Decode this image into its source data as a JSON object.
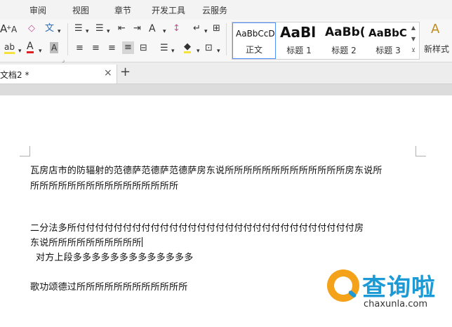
{
  "menu": [
    "审阅",
    "视图",
    "章节",
    "开发工具",
    "云服务"
  ],
  "ribbon": {
    "font_group": {
      "grow_font": "A",
      "shrink_font": "A",
      "clear_format": "◇",
      "pinyin": "文",
      "highlight": "ab",
      "font_color": "A",
      "char_shading": "A"
    },
    "paragraph_group": {
      "bullets": "☰",
      "numbering": "☰",
      "decrease_indent": "⇤",
      "increase_indent": "⇥",
      "cjk_layout": "A",
      "sort": "↕",
      "show_marks": "↵",
      "table": "⊞",
      "align_left": "≡",
      "align_center": "≡",
      "align_right": "≡",
      "justify": "≡",
      "distributed": "⊟",
      "line_spacing": "☰",
      "shading": "◆",
      "borders": "⊡"
    },
    "styles": [
      {
        "sample": "AaBbCcDd",
        "label": "正文",
        "selected": true
      },
      {
        "sample": "AaBl",
        "label": "标题 1",
        "selected": false
      },
      {
        "sample": "AaBb(",
        "label": "标题 2",
        "selected": false
      },
      {
        "sample": "AaBbC",
        "label": "标题 3",
        "selected": false
      }
    ],
    "new_style_label": "新样式",
    "new_style_icon": "A"
  },
  "tabs": {
    "document_label": "文档2 *",
    "close": "×",
    "new_tab": "+"
  },
  "document": {
    "lines": [
      "瓦房店市的防辐射的范德萨范德萨范德萨房东说所所所所所所所所所所所所所房东说所",
      "所所所所所所所所所所所所所所所所",
      "二分法多所付付付付付付付付付付付付付付付付付付付付付付付付付付付付付付房",
      "东说所所所所所所所所所所",
      "对方上段多多多多多多多多多多多多多",
      "歌功颂德过所所所所所所所所所所所所"
    ]
  },
  "watermark": {
    "title": "查询啦",
    "url": "chaxunla.com"
  }
}
